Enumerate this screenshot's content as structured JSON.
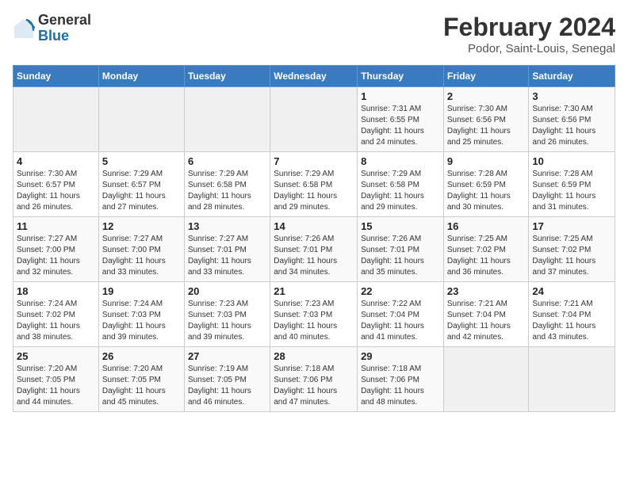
{
  "header": {
    "logo_line1": "General",
    "logo_line2": "Blue",
    "title": "February 2024",
    "subtitle": "Podor, Saint-Louis, Senegal"
  },
  "columns": [
    "Sunday",
    "Monday",
    "Tuesday",
    "Wednesday",
    "Thursday",
    "Friday",
    "Saturday"
  ],
  "weeks": [
    [
      {
        "day": "",
        "info": ""
      },
      {
        "day": "",
        "info": ""
      },
      {
        "day": "",
        "info": ""
      },
      {
        "day": "",
        "info": ""
      },
      {
        "day": "1",
        "info": "Sunrise: 7:31 AM\nSunset: 6:55 PM\nDaylight: 11 hours\nand 24 minutes."
      },
      {
        "day": "2",
        "info": "Sunrise: 7:30 AM\nSunset: 6:56 PM\nDaylight: 11 hours\nand 25 minutes."
      },
      {
        "day": "3",
        "info": "Sunrise: 7:30 AM\nSunset: 6:56 PM\nDaylight: 11 hours\nand 26 minutes."
      }
    ],
    [
      {
        "day": "4",
        "info": "Sunrise: 7:30 AM\nSunset: 6:57 PM\nDaylight: 11 hours\nand 26 minutes."
      },
      {
        "day": "5",
        "info": "Sunrise: 7:29 AM\nSunset: 6:57 PM\nDaylight: 11 hours\nand 27 minutes."
      },
      {
        "day": "6",
        "info": "Sunrise: 7:29 AM\nSunset: 6:58 PM\nDaylight: 11 hours\nand 28 minutes."
      },
      {
        "day": "7",
        "info": "Sunrise: 7:29 AM\nSunset: 6:58 PM\nDaylight: 11 hours\nand 29 minutes."
      },
      {
        "day": "8",
        "info": "Sunrise: 7:29 AM\nSunset: 6:58 PM\nDaylight: 11 hours\nand 29 minutes."
      },
      {
        "day": "9",
        "info": "Sunrise: 7:28 AM\nSunset: 6:59 PM\nDaylight: 11 hours\nand 30 minutes."
      },
      {
        "day": "10",
        "info": "Sunrise: 7:28 AM\nSunset: 6:59 PM\nDaylight: 11 hours\nand 31 minutes."
      }
    ],
    [
      {
        "day": "11",
        "info": "Sunrise: 7:27 AM\nSunset: 7:00 PM\nDaylight: 11 hours\nand 32 minutes."
      },
      {
        "day": "12",
        "info": "Sunrise: 7:27 AM\nSunset: 7:00 PM\nDaylight: 11 hours\nand 33 minutes."
      },
      {
        "day": "13",
        "info": "Sunrise: 7:27 AM\nSunset: 7:01 PM\nDaylight: 11 hours\nand 33 minutes."
      },
      {
        "day": "14",
        "info": "Sunrise: 7:26 AM\nSunset: 7:01 PM\nDaylight: 11 hours\nand 34 minutes."
      },
      {
        "day": "15",
        "info": "Sunrise: 7:26 AM\nSunset: 7:01 PM\nDaylight: 11 hours\nand 35 minutes."
      },
      {
        "day": "16",
        "info": "Sunrise: 7:25 AM\nSunset: 7:02 PM\nDaylight: 11 hours\nand 36 minutes."
      },
      {
        "day": "17",
        "info": "Sunrise: 7:25 AM\nSunset: 7:02 PM\nDaylight: 11 hours\nand 37 minutes."
      }
    ],
    [
      {
        "day": "18",
        "info": "Sunrise: 7:24 AM\nSunset: 7:02 PM\nDaylight: 11 hours\nand 38 minutes."
      },
      {
        "day": "19",
        "info": "Sunrise: 7:24 AM\nSunset: 7:03 PM\nDaylight: 11 hours\nand 39 minutes."
      },
      {
        "day": "20",
        "info": "Sunrise: 7:23 AM\nSunset: 7:03 PM\nDaylight: 11 hours\nand 39 minutes."
      },
      {
        "day": "21",
        "info": "Sunrise: 7:23 AM\nSunset: 7:03 PM\nDaylight: 11 hours\nand 40 minutes."
      },
      {
        "day": "22",
        "info": "Sunrise: 7:22 AM\nSunset: 7:04 PM\nDaylight: 11 hours\nand 41 minutes."
      },
      {
        "day": "23",
        "info": "Sunrise: 7:21 AM\nSunset: 7:04 PM\nDaylight: 11 hours\nand 42 minutes."
      },
      {
        "day": "24",
        "info": "Sunrise: 7:21 AM\nSunset: 7:04 PM\nDaylight: 11 hours\nand 43 minutes."
      }
    ],
    [
      {
        "day": "25",
        "info": "Sunrise: 7:20 AM\nSunset: 7:05 PM\nDaylight: 11 hours\nand 44 minutes."
      },
      {
        "day": "26",
        "info": "Sunrise: 7:20 AM\nSunset: 7:05 PM\nDaylight: 11 hours\nand 45 minutes."
      },
      {
        "day": "27",
        "info": "Sunrise: 7:19 AM\nSunset: 7:05 PM\nDaylight: 11 hours\nand 46 minutes."
      },
      {
        "day": "28",
        "info": "Sunrise: 7:18 AM\nSunset: 7:06 PM\nDaylight: 11 hours\nand 47 minutes."
      },
      {
        "day": "29",
        "info": "Sunrise: 7:18 AM\nSunset: 7:06 PM\nDaylight: 11 hours\nand 48 minutes."
      },
      {
        "day": "",
        "info": ""
      },
      {
        "day": "",
        "info": ""
      }
    ]
  ]
}
